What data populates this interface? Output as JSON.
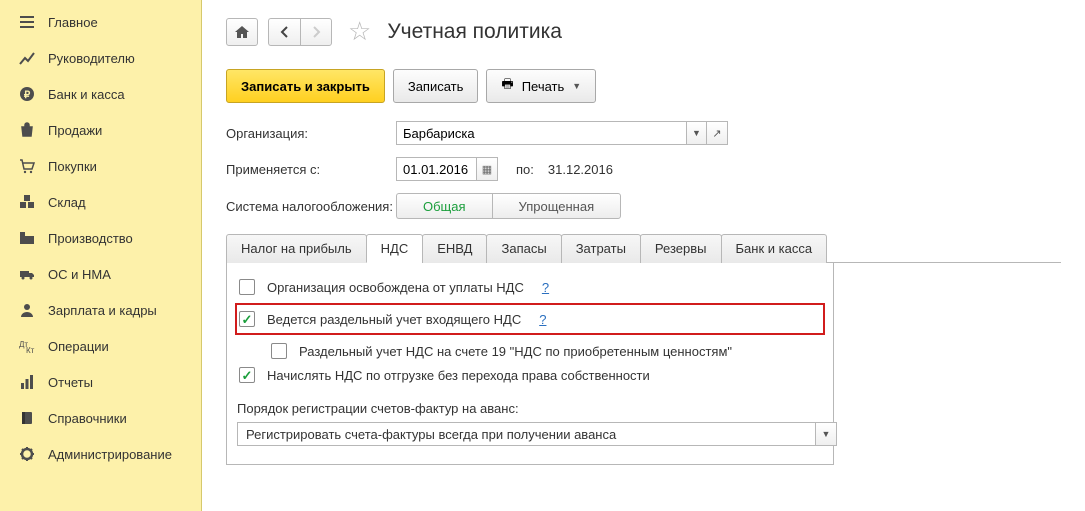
{
  "sidebar": {
    "items": [
      {
        "label": "Главное",
        "icon": "menu"
      },
      {
        "label": "Руководителю",
        "icon": "chart"
      },
      {
        "label": "Банк и касса",
        "icon": "ruble"
      },
      {
        "label": "Продажи",
        "icon": "bag"
      },
      {
        "label": "Покупки",
        "icon": "cart"
      },
      {
        "label": "Склад",
        "icon": "boxes"
      },
      {
        "label": "Производство",
        "icon": "factory"
      },
      {
        "label": "ОС и НМА",
        "icon": "truck"
      },
      {
        "label": "Зарплата и кадры",
        "icon": "person"
      },
      {
        "label": "Операции",
        "icon": "ops"
      },
      {
        "label": "Отчеты",
        "icon": "report"
      },
      {
        "label": "Справочники",
        "icon": "book"
      },
      {
        "label": "Администрирование",
        "icon": "gear"
      }
    ]
  },
  "page": {
    "title": "Учетная политика"
  },
  "actions": {
    "save_close": "Записать и закрыть",
    "save": "Записать",
    "print": "Печать"
  },
  "form": {
    "org_label": "Организация:",
    "org_value": "Барбариска",
    "applies_label": "Применяется с:",
    "date_from": "01.01.2016",
    "to_label": "по:",
    "date_to": "31.12.2016",
    "tax_label": "Система налогообложения:",
    "tax_general": "Общая",
    "tax_simple": "Упрощенная"
  },
  "tabs": [
    {
      "label": "Налог на прибыль"
    },
    {
      "label": "НДС",
      "active": true
    },
    {
      "label": "ЕНВД"
    },
    {
      "label": "Запасы"
    },
    {
      "label": "Затраты"
    },
    {
      "label": "Резервы"
    },
    {
      "label": "Банк и касса"
    }
  ],
  "nds": {
    "chk1": "Организация освобождена от уплаты НДС",
    "chk2": "Ведется раздельный учет входящего НДС",
    "chk3": "Раздельный учет НДС на счете 19 \"НДС по приобретенным ценностям\"",
    "chk4": "Начислять НДС по отгрузке без перехода права собственности",
    "order_label": "Порядок регистрации счетов-фактур на аванс:",
    "order_value": "Регистрировать счета-фактуры всегда при получении аванса",
    "help": "?"
  }
}
